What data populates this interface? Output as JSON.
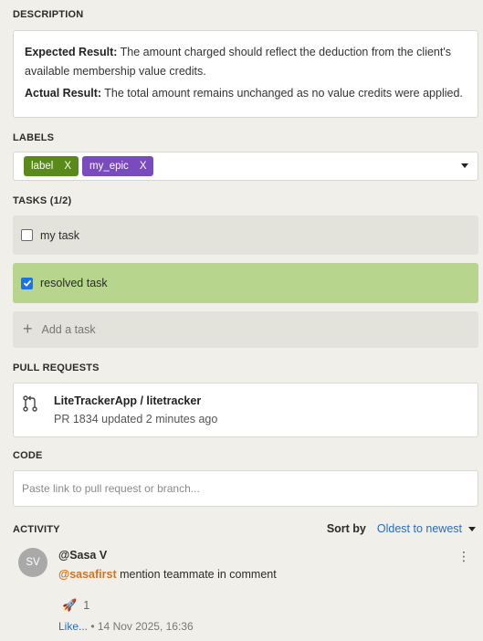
{
  "description": {
    "title": "DESCRIPTION",
    "expected_label": "Expected Result:",
    "expected_text": " The amount charged should reflect the deduction from the client's available membership value credits.",
    "actual_label": "Actual Result:",
    "actual_text": " The total amount remains unchanged as no value credits were applied."
  },
  "labels": {
    "title": "LABELS",
    "items": [
      {
        "name": "label",
        "remove": "X",
        "color": "#5a8a1a"
      },
      {
        "name": "my_epic",
        "remove": "X",
        "color": "#7a4bbf"
      }
    ]
  },
  "tasks": {
    "title": "TASKS (1/2)",
    "items": [
      {
        "label": "my task",
        "checked": false
      },
      {
        "label": "resolved task",
        "checked": true
      }
    ],
    "add_label": "Add a task"
  },
  "pull_requests": {
    "title": "PULL REQUESTS",
    "item": {
      "repo": "LiteTrackerApp / litetracker",
      "meta": "PR 1834 updated 2 minutes ago"
    }
  },
  "code": {
    "title": "CODE",
    "placeholder": "Paste link to pull request or branch..."
  },
  "activity": {
    "title": "ACTIVITY",
    "sort_label": "Sort by",
    "sort_value": "Oldest to newest",
    "comment": {
      "avatar_initials": "SV",
      "author": "@Sasa V",
      "mention": "@sasafirst",
      "text": " mention teammate in comment",
      "reaction_emoji": "🚀",
      "reaction_count": "1",
      "like_label": "Like...",
      "timestamp": " • 14 Nov 2025, 16:36",
      "menu_icon": "kebab-icon"
    }
  },
  "colors": {
    "accent_link": "#2a6dbb",
    "mention": "#d4741d",
    "resolved_bg": "#b7d58c"
  }
}
